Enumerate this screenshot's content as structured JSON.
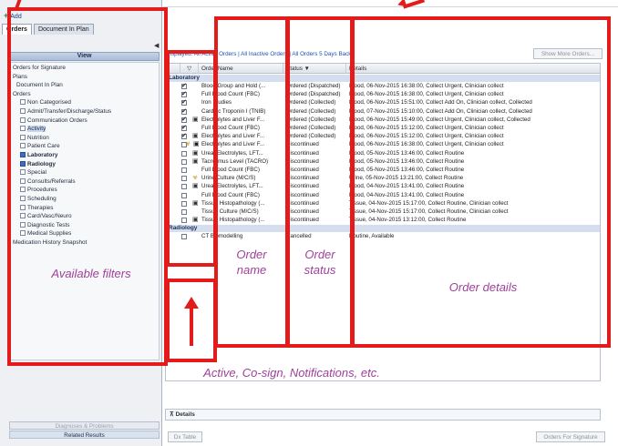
{
  "toolbar": {
    "add_label": "Add"
  },
  "tabs": [
    {
      "label": "Orders"
    },
    {
      "label": "Document In Plan"
    }
  ],
  "view_header": "View",
  "filter_tree": [
    {
      "label": "Orders for Signature",
      "indent": 0,
      "checkbox": false,
      "checked": false
    },
    {
      "label": "Plans",
      "indent": 0,
      "checkbox": false,
      "checked": false
    },
    {
      "label": "Document In Plan",
      "indent": 1,
      "checkbox": false,
      "checked": false
    },
    {
      "label": "Orders",
      "indent": 0,
      "checkbox": false,
      "checked": false
    },
    {
      "label": "Non Categorised",
      "indent": 2,
      "checkbox": true,
      "checked": false
    },
    {
      "label": "Admit/Transfer/Discharge/Status",
      "indent": 2,
      "checkbox": true,
      "checked": false
    },
    {
      "label": "Communication Orders",
      "indent": 2,
      "checkbox": true,
      "checked": false
    },
    {
      "label": "Activity",
      "indent": 2,
      "checkbox": true,
      "checked": false,
      "selected": true
    },
    {
      "label": "Nutrition",
      "indent": 2,
      "checkbox": true,
      "checked": false
    },
    {
      "label": "Patient Care",
      "indent": 2,
      "checkbox": true,
      "checked": false
    },
    {
      "label": "Laboratory",
      "indent": 2,
      "checkbox": true,
      "checked": true,
      "bold": true
    },
    {
      "label": "Radiology",
      "indent": 2,
      "checkbox": true,
      "checked": true,
      "bold": true
    },
    {
      "label": "Special",
      "indent": 2,
      "checkbox": true,
      "checked": false
    },
    {
      "label": "Consults/Referrals",
      "indent": 2,
      "checkbox": true,
      "checked": false
    },
    {
      "label": "Procedures",
      "indent": 2,
      "checkbox": true,
      "checked": false
    },
    {
      "label": "Scheduling",
      "indent": 2,
      "checkbox": true,
      "checked": false
    },
    {
      "label": "Therapies",
      "indent": 2,
      "checkbox": true,
      "checked": false
    },
    {
      "label": "Card/Vasc/Neuro",
      "indent": 2,
      "checkbox": true,
      "checked": false
    },
    {
      "label": "Diagnostic Tests",
      "indent": 2,
      "checkbox": true,
      "checked": false
    },
    {
      "label": "Medical Supplies",
      "indent": 2,
      "checkbox": true,
      "checked": false
    },
    {
      "label": "Medication History Snapshot",
      "indent": 0,
      "checkbox": false,
      "checked": false
    }
  ],
  "bottom_left_tabs": [
    {
      "label": "Diagnoses & Problems",
      "disabled": true
    },
    {
      "label": "Related Results",
      "disabled": false
    }
  ],
  "displayed_text": "Displayed: All Active Orders | All Inactive Orders | All Orders 5 Days Back",
  "show_more_label": "Show More Orders...",
  "columns": [
    "",
    "",
    "Order Name",
    "Status",
    "Details"
  ],
  "groups": [
    {
      "name": "Laboratory",
      "rows": [
        {
          "checked": true,
          "flag": "",
          "order": "Blood Group and Hold (...",
          "status": "Ordered (Dispatched)",
          "details": "Blood, 06-Nov-2015 16:38:00, Collect Urgent, Clinician collect"
        },
        {
          "checked": true,
          "flag": "",
          "order": "Full Blood Count (FBC)",
          "status": "Ordered (Dispatched)",
          "details": "Blood, 06-Nov-2015 16:38:00, Collect Urgent, Clinician collect"
        },
        {
          "checked": true,
          "flag": "",
          "order": "Iron Studies",
          "status": "Ordered (Collected)",
          "details": "Blood, 06-Nov-2015 15:51:00, Collect Add On, Clinician collect, Collected"
        },
        {
          "checked": true,
          "flag": "",
          "order": "Cardiac Troponin I (TNIB)",
          "status": "Ordered (Collected)",
          "details": "Blood, 07-Nov-2015 15:10:00, Collect Add On, Clinician collect, Collected"
        },
        {
          "checked": true,
          "flag": "note",
          "order": "Electrolytes and Liver F...",
          "status": "Ordered (Collected)",
          "details": "Blood, 06-Nov-2015 15:49:00, Collect Urgent, Clinician collect, Collected"
        },
        {
          "checked": true,
          "flag": "",
          "order": "Full Blood Count (FBC)",
          "status": "Ordered (Collected)",
          "details": "Blood, 06-Nov-2015 15:12:00, Collect Urgent, Clinician collect"
        },
        {
          "checked": true,
          "flag": "note",
          "order": "Electrolytes and Liver F...",
          "status": "Ordered (Collected)",
          "details": "Blood, 06-Nov-2015 15:12:00, Collect Urgent, Clinician collect"
        },
        {
          "checked": false,
          "flag": "both",
          "order": "Electrolytes and Liver F...",
          "status": "Discontinued",
          "details": "Blood, 06-Nov-2015 16:38:00, Collect Urgent, Clinician collect"
        },
        {
          "checked": false,
          "flag": "note",
          "order": "Urea, Electrolytes, LFT...",
          "status": "Discontinued",
          "details": "Blood, 05-Nov-2015 13:46:00, Collect Routine"
        },
        {
          "checked": false,
          "flag": "note",
          "order": "Tacrolimus Level (TACRO)",
          "status": "Discontinued",
          "details": "Blood, 05-Nov-2015 13:46:00, Collect Routine"
        },
        {
          "checked": false,
          "flag": "",
          "order": "Full Blood Count (FBC)",
          "status": "Discontinued",
          "details": "Blood, 05-Nov-2015 13:46:00, Collect Routine"
        },
        {
          "checked": false,
          "flag": "pin",
          "order": "Urine Culture (M/C/S)",
          "status": "Discontinued",
          "details": "Urine, 05-Nov-2015 13:21:00, Collect Routine"
        },
        {
          "checked": false,
          "flag": "note",
          "order": "Urea, Electrolytes, LFT...",
          "status": "Discontinued",
          "details": "Blood, 04-Nov-2015 13:41:00, Collect Routine"
        },
        {
          "checked": false,
          "flag": "",
          "order": "Full Blood Count (FBC)",
          "status": "Discontinued",
          "details": "Blood, 04-Nov-2015 13:41:00, Collect Routine"
        },
        {
          "checked": false,
          "flag": "note",
          "order": "Tissue Histopathology (...",
          "status": "Discontinued",
          "details": "Tissue, 04-Nov-2015 15:17:00, Collect Routine, Clinician collect"
        },
        {
          "checked": false,
          "flag": "",
          "order": "Tissue Culture (M/C/S)",
          "status": "Discontinued",
          "details": "Tissue, 04-Nov-2015 15:17:00, Collect Routine, Clinician collect"
        },
        {
          "checked": false,
          "flag": "note",
          "order": "Tissue Histopathology (...",
          "status": "Discontinued",
          "details": "Tissue, 04-Nov-2015 13:12:00, Collect Routine"
        }
      ]
    },
    {
      "name": "Radiology",
      "rows": [
        {
          "checked": false,
          "flag": "",
          "order": "CT Biomodelling",
          "status": "Cancelled",
          "details": "Routine, Available"
        }
      ]
    }
  ],
  "details_label": "Details",
  "dx_table_label": "Dx Table",
  "sign_label": "Orders For Signature",
  "annotations": {
    "available_filters": "Available filters",
    "order_name": "Order name",
    "order_status": "Order status",
    "order_details": "Order details",
    "active_note": "Active, Co-sign, Notifications, etc."
  },
  "colors": {
    "annotation_red": "#e31b1b",
    "annotation_text": "#a0409a",
    "group_band": "#d4deef"
  }
}
